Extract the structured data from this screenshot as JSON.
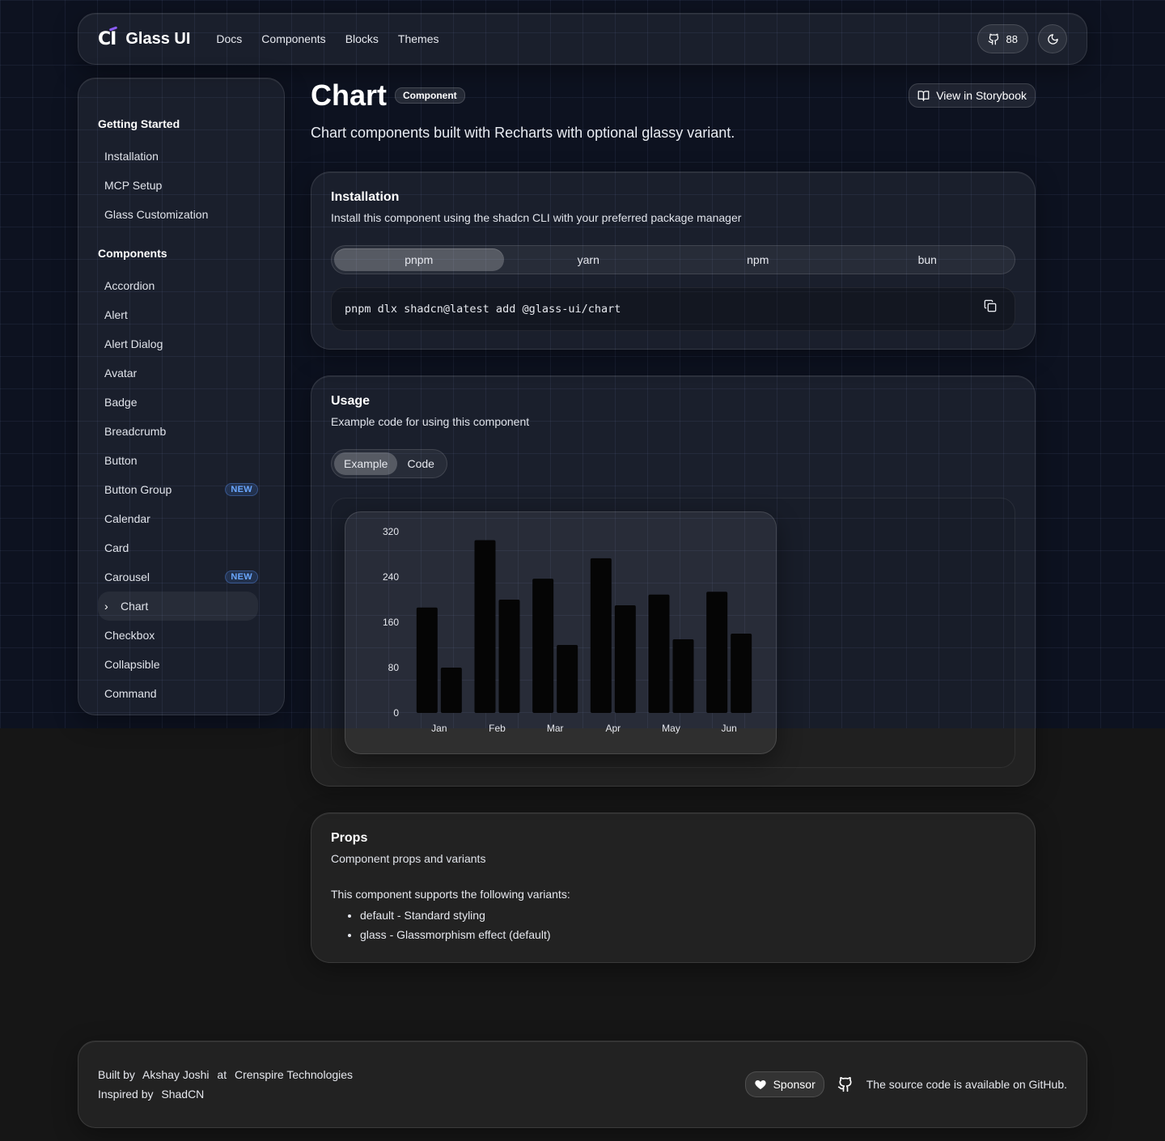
{
  "header": {
    "logo_mark": "CI",
    "logo_text": "Glass UI",
    "nav": [
      "Docs",
      "Components",
      "Blocks",
      "Themes"
    ],
    "github_count": "88"
  },
  "sidebar": {
    "groups": [
      {
        "title": "Getting Started",
        "items": [
          "Installation",
          "MCP Setup",
          "Glass Customization"
        ]
      },
      {
        "title": "Components",
        "items": [
          "Accordion",
          "Alert",
          "Alert Dialog",
          "Avatar",
          "Badge",
          "Breadcrumb",
          "Button",
          "Button Group",
          "Calendar",
          "Card",
          "Carousel",
          "Chart",
          "Checkbox",
          "Collapsible",
          "Command"
        ]
      }
    ],
    "new_badge": "NEW",
    "active_item": "Chart"
  },
  "page": {
    "title": "Chart",
    "badge": "Component",
    "storybook_label": "View in Storybook",
    "description": "Chart components built with Recharts with optional glassy variant."
  },
  "installation": {
    "title": "Installation",
    "subtitle": "Install this component using the shadcn CLI with your preferred package manager",
    "tabs": [
      "pnpm",
      "yarn",
      "npm",
      "bun"
    ],
    "active_tab": "pnpm",
    "command": "pnpm dlx shadcn@latest add @glass-ui/chart"
  },
  "usage": {
    "title": "Usage",
    "subtitle": "Example code for using this component",
    "tabs": [
      "Example",
      "Code"
    ],
    "active_tab": "Example"
  },
  "chart_data": {
    "type": "bar",
    "categories": [
      "Jan",
      "Feb",
      "Mar",
      "Apr",
      "May",
      "Jun"
    ],
    "series": [
      {
        "values": [
          186,
          305,
          237,
          273,
          209,
          214
        ]
      },
      {
        "values": [
          80,
          200,
          120,
          190,
          130,
          140
        ]
      }
    ],
    "ylim": [
      0,
      320
    ],
    "yticks": [
      0,
      80,
      160,
      240,
      320
    ],
    "bar_color": "#050505",
    "grid": false
  },
  "props": {
    "title": "Props",
    "subtitle": "Component props and variants",
    "intro": "This component supports the following variants:",
    "variants": [
      "default - Standard styling",
      "glass - Glassmorphism effect (default)"
    ]
  },
  "footer": {
    "built_by": "Built by",
    "author": "Akshay Joshi",
    "at": "at",
    "company": "Crenspire Technologies",
    "inspired_by": "Inspired by",
    "inspiration": "ShadCN",
    "sponsor_label": "Sponsor",
    "source_text": "The source code is available on GitHub."
  }
}
